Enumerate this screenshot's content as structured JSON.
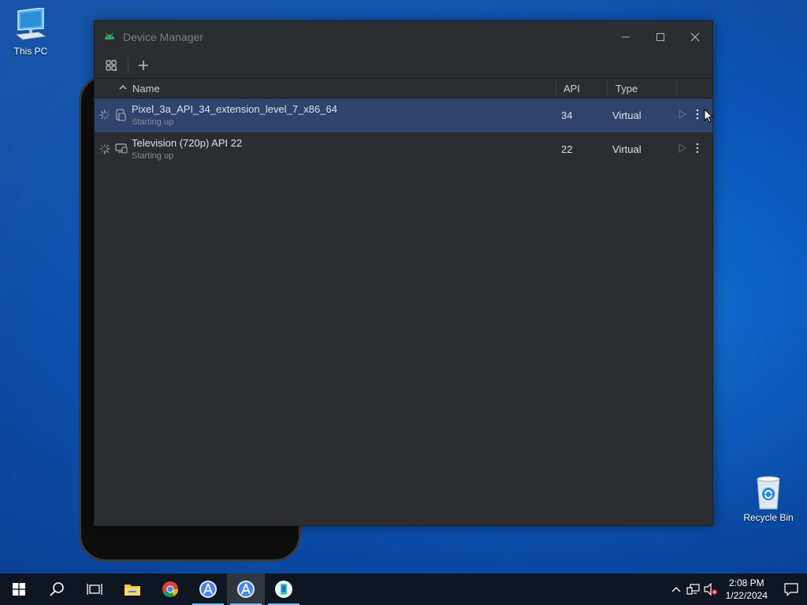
{
  "desktop": {
    "icons": [
      {
        "label": "This PC",
        "icon": "computer-icon"
      },
      {
        "label": "Recycle Bin",
        "icon": "recycle-bin-icon"
      }
    ]
  },
  "window": {
    "title": "Device Manager",
    "app_icon": "android-icon",
    "controls": {
      "minimize": "─",
      "maximize": "☐",
      "close": "✕"
    }
  },
  "toolbar": {
    "group_icon": "group-devices-icon",
    "add_icon": "add-icon",
    "add_label": "+"
  },
  "table": {
    "columns": {
      "name": "Name",
      "api": "API",
      "type": "Type"
    },
    "rows": [
      {
        "name": "Pixel_3a_API_34_extension_level_7_x86_64",
        "status": "Starting up",
        "api": "34",
        "type": "Virtual",
        "device_icon": "phone-device-icon",
        "selected": true
      },
      {
        "name": "Television (720p) API 22",
        "status": "Starting up",
        "api": "22",
        "type": "Virtual",
        "device_icon": "tv-device-icon",
        "selected": false
      }
    ]
  },
  "taskbar": {
    "items": [
      "start-icon",
      "search-icon",
      "task-view-icon",
      "file-explorer-icon",
      "chrome-icon",
      "android-studio-icon",
      "android-studio-icon",
      "emulator-icon"
    ],
    "clock": {
      "time": "2:08 PM",
      "date": "1/22/2024"
    }
  },
  "colors": {
    "window_bg": "#2b2d30",
    "selected_row": "#2e436e",
    "taskbar_bg": "#0e1621"
  }
}
